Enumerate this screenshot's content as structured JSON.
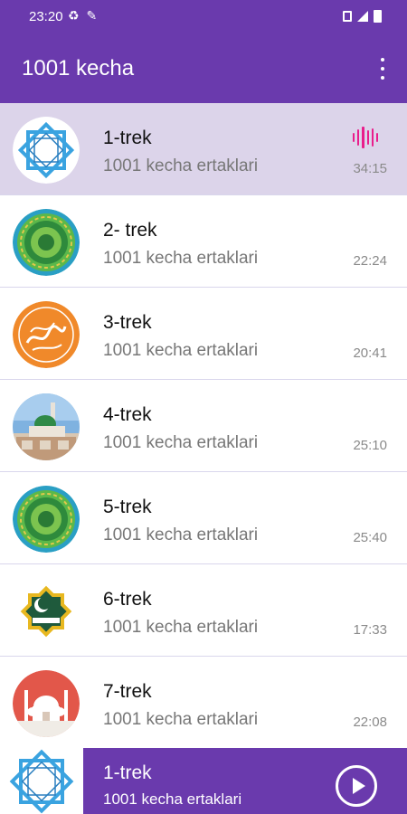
{
  "status_bar": {
    "time": "23:20",
    "left_icons": [
      "sync-icon",
      "wrench-icon"
    ],
    "right_icons": [
      "mute-icon",
      "signal-icon",
      "battery-icon"
    ]
  },
  "app_bar": {
    "title": "1001 kecha",
    "menu_icon": "more-vert-icon"
  },
  "colors": {
    "primary": "#6a3aad",
    "active_row": "#dcd4ea",
    "equalizer": "#e91e8c"
  },
  "tracks": [
    {
      "title": "1-trek",
      "subtitle": "1001 kecha ertaklari",
      "duration": "34:15",
      "playing": true,
      "icon": "star-octagon-icon"
    },
    {
      "title": "2- trek",
      "subtitle": "1001 kecha ertaklari",
      "duration": "22:24",
      "playing": false,
      "icon": "green-mandala-icon"
    },
    {
      "title": "3-trek",
      "subtitle": "1001 kecha ertaklari",
      "duration": "20:41",
      "playing": false,
      "icon": "calligraphy-icon"
    },
    {
      "title": "4-trek",
      "subtitle": "1001 kecha ertaklari",
      "duration": "25:10",
      "playing": false,
      "icon": "mosque-photo-icon"
    },
    {
      "title": "5-trek",
      "subtitle": "1001 kecha ertaklari",
      "duration": "25:40",
      "playing": false,
      "icon": "green-mandala-icon"
    },
    {
      "title": "6-trek",
      "subtitle": "1001 kecha ertaklari",
      "duration": "17:33",
      "playing": false,
      "icon": "crescent-star-icon"
    },
    {
      "title": "7-trek",
      "subtitle": "1001 kecha ertaklari",
      "duration": "22:08",
      "playing": false,
      "icon": "mosque-domes-icon"
    }
  ],
  "player": {
    "title": "1-trek",
    "subtitle": "1001 kecha ertaklari",
    "icon": "star-octagon-icon",
    "button_icon": "play-icon"
  }
}
